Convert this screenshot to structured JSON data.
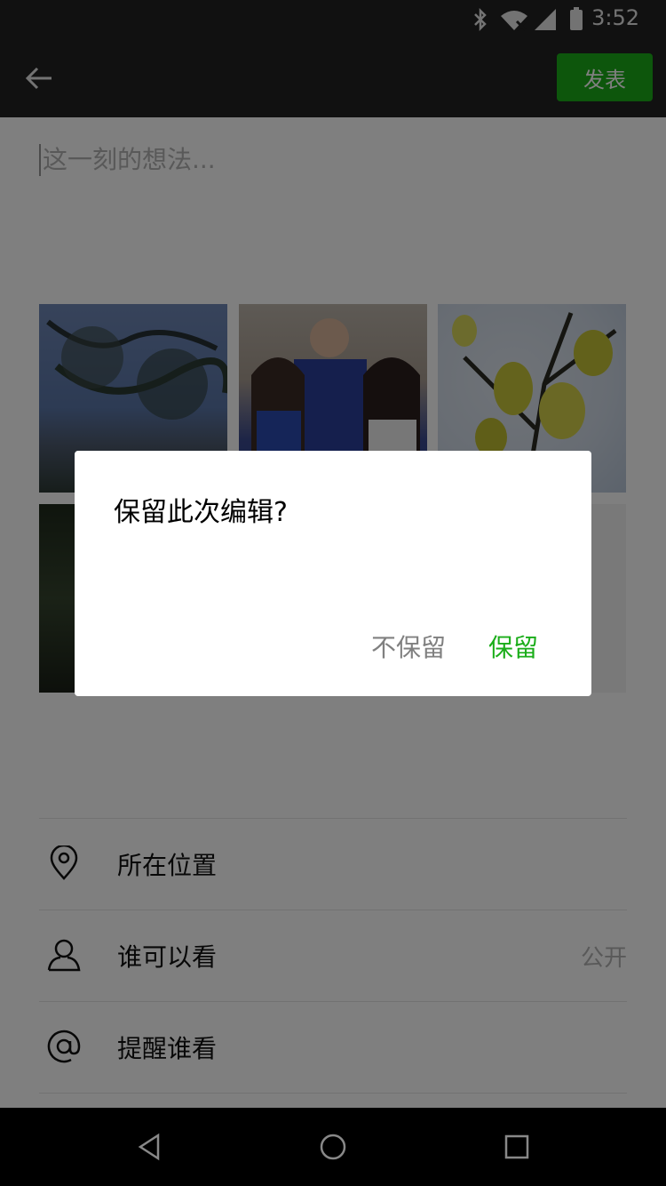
{
  "status": {
    "time": "3:52"
  },
  "appbar": {
    "publish_label": "发表"
  },
  "composer": {
    "placeholder": "这一刻的想法..."
  },
  "options": [
    {
      "label": "所在位置",
      "value": ""
    },
    {
      "label": "谁可以看",
      "value": "公开"
    },
    {
      "label": "提醒谁看",
      "value": ""
    }
  ],
  "dialog": {
    "title": "保留此次编辑?",
    "cancel_label": "不保留",
    "confirm_label": "保留"
  },
  "colors": {
    "accent": "#1aad19",
    "dark_bar": "#222222"
  },
  "icons": {
    "back": "arrow-left-icon",
    "location": "location-pin-icon",
    "visibility": "person-icon",
    "mention": "at-sign-icon"
  }
}
